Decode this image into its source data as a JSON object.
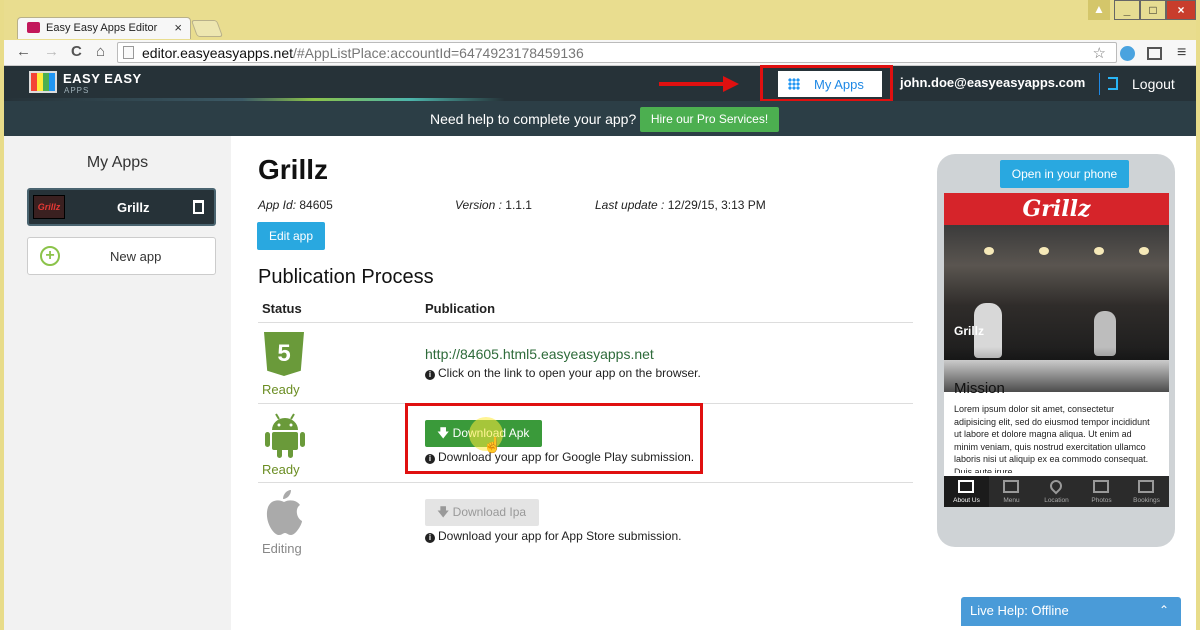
{
  "browser": {
    "tab_title": "Easy Easy Apps Editor",
    "tab_close": "×",
    "url_host": "editor.easyeasyapps.net",
    "url_path": "/#AppListPlace:accountId=6474923178459136",
    "nav_back": "←",
    "nav_forward": "→",
    "nav_reload": "C",
    "nav_home": "⌂",
    "star": "☆",
    "menu": "≡",
    "win_user": "▲",
    "win_min": "_",
    "win_max": "□",
    "win_close": "×"
  },
  "header": {
    "logo_text": "EASY EASY",
    "logo_sub": "APPS",
    "my_apps": "My Apps",
    "user_email": "john.doe@easyeasyapps.com",
    "logout": "Logout"
  },
  "helpbar": {
    "text": "Need help to complete your app?",
    "pro_button": "Hire our Pro Services!"
  },
  "sidebar": {
    "title": "My Apps",
    "apps": [
      {
        "name": "Grillz",
        "thumb": "Grillz"
      }
    ],
    "new_app": "New app",
    "plus": "+"
  },
  "main": {
    "title": "Grillz",
    "app_id_label": "App Id:",
    "app_id": "84605",
    "version_label": "Version :",
    "version": "1.1.1",
    "last_update_label": "Last update :",
    "last_update": "12/29/15, 3:13 PM",
    "edit_button": "Edit app",
    "publication_title": "Publication Process",
    "col_status": "Status",
    "col_publication": "Publication",
    "rows": [
      {
        "platform_icon": "html5-icon",
        "status": "Ready",
        "link": "http://84605.html5.easyeasyapps.net",
        "hint": "Click on the link to open your app on the browser."
      },
      {
        "platform_icon": "android-icon",
        "status": "Ready",
        "button": "Download Apk",
        "hint": "Download your app for Google Play submission."
      },
      {
        "platform_icon": "apple-icon",
        "status": "Editing",
        "button": "Download Ipa",
        "hint": "Download your app for App Store submission."
      }
    ]
  },
  "preview": {
    "open_button": "Open in your phone",
    "app_header": "Grillz",
    "photo_caption": "Grillz",
    "section_title": "Mission",
    "body_text": "Lorem ipsum dolor sit amet, consectetur adipisicing elit, sed do eiusmod tempor incididunt ut labore et dolore magna aliqua. Ut enim ad minim veniam, quis nostrud exercitation ullamco laboris nisi ut aliquip ex ea commodo consequat. Duis aute irure",
    "tabs": [
      "About Us",
      "Menu",
      "Location",
      "Photos",
      "Bookings"
    ],
    "active_tab": 0
  },
  "livehelp": {
    "label": "Live Help: Offline",
    "chevron": "⌃"
  },
  "colors": {
    "header_bg": "#263238",
    "accent_blue": "#29a8e0",
    "green": "#4caf50",
    "highlight_red": "#e01010"
  }
}
